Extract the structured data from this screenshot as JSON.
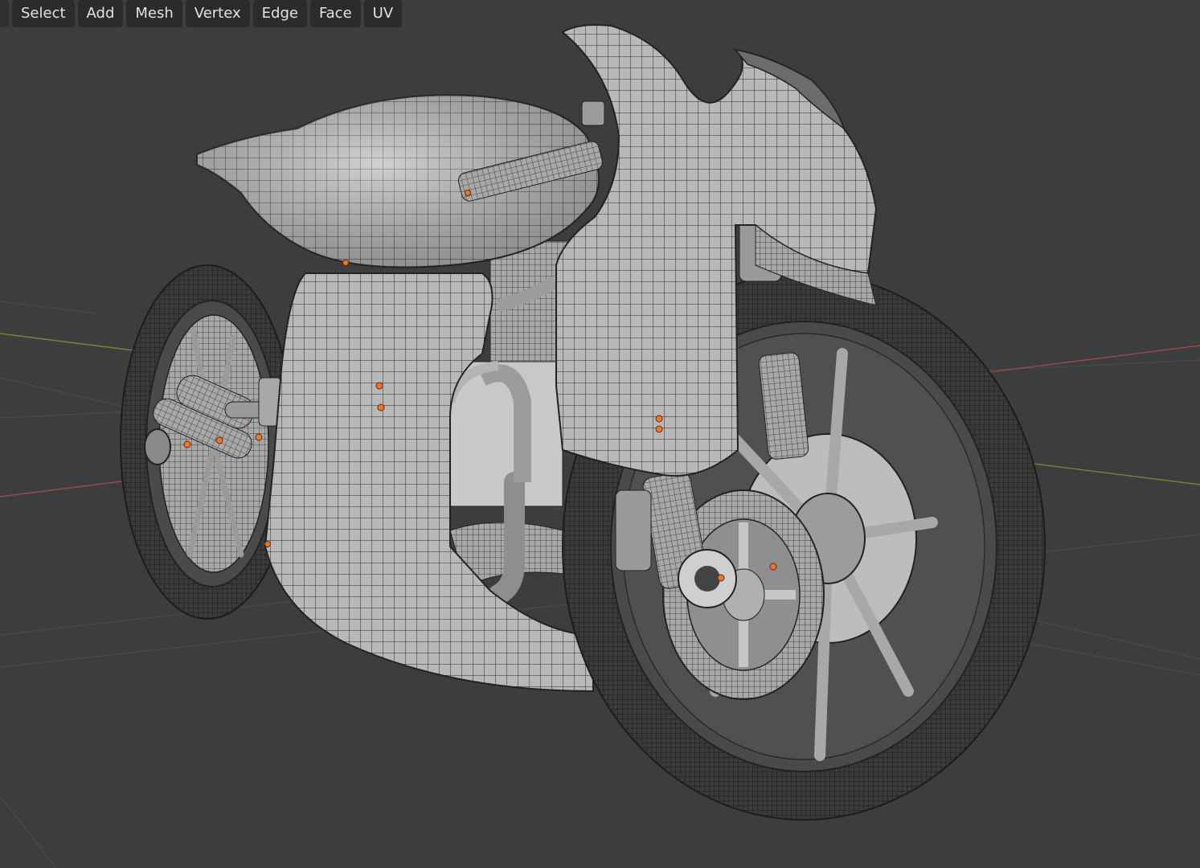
{
  "menubar": {
    "items": [
      {
        "label": "Select"
      },
      {
        "label": "Add"
      },
      {
        "label": "Mesh"
      },
      {
        "label": "Vertex"
      },
      {
        "label": "Edge"
      },
      {
        "label": "Face"
      },
      {
        "label": "UV"
      }
    ]
  },
  "viewport": {
    "mode": "Edit Mode",
    "shading": "solid with wireframe overlay",
    "object": "motorcycle-mesh",
    "colors": {
      "background": "#3d3d3d",
      "grid": "#4a4a4a",
      "x_axis": "#9a4a4a",
      "y_axis": "#6a8a3a",
      "mesh": "#b9b9b9",
      "wire": "#1e1e1e",
      "tire": "#3a3a3a",
      "vertex_selected": "#e8782e"
    }
  }
}
